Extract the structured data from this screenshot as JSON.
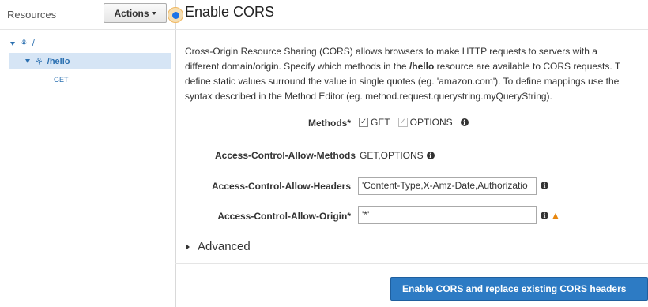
{
  "sidebar": {
    "title": "Resources",
    "actions_label": "Actions",
    "tree": {
      "root_path": "/",
      "child_path": "/hello",
      "child_method": "GET"
    }
  },
  "main": {
    "title": "Enable CORS",
    "description": {
      "line1": "Cross-Origin Resource Sharing (CORS) allows browsers to make HTTP requests to servers with a",
      "line2_pre": "different domain/origin. Specify which methods in the ",
      "line2_bold": "/hello",
      "line2_post": " resource are available to CORS requests. T",
      "line3": "define static values surround the value in single quotes (eg. 'amazon.com'). To define mappings use the",
      "line4": "syntax described in the Method Editor (eg. method.request.querystring.myQueryString)."
    },
    "methods": {
      "label": "Methods*",
      "get_label": "GET",
      "get_checked": true,
      "options_label": "OPTIONS",
      "options_checked": true,
      "options_disabled": true
    },
    "allow_methods": {
      "label": "Access-Control-Allow-Methods",
      "value": "GET,OPTIONS"
    },
    "allow_headers": {
      "label": "Access-Control-Allow-Headers",
      "value": "'Content-Type,X-Amz-Date,Authorizatio"
    },
    "allow_origin": {
      "label": "Access-Control-Allow-Origin*",
      "value": "'*'"
    },
    "advanced_label": "Advanced",
    "submit_label": "Enable CORS and replace existing CORS headers"
  },
  "colors": {
    "primary": "#2d7bc4",
    "selection": "#d6e5f5",
    "warning": "#e8870e",
    "link": "#2a6fb0"
  },
  "icons": {
    "info": "info-icon",
    "warning": "warning-icon",
    "resource": "resource-icon"
  }
}
